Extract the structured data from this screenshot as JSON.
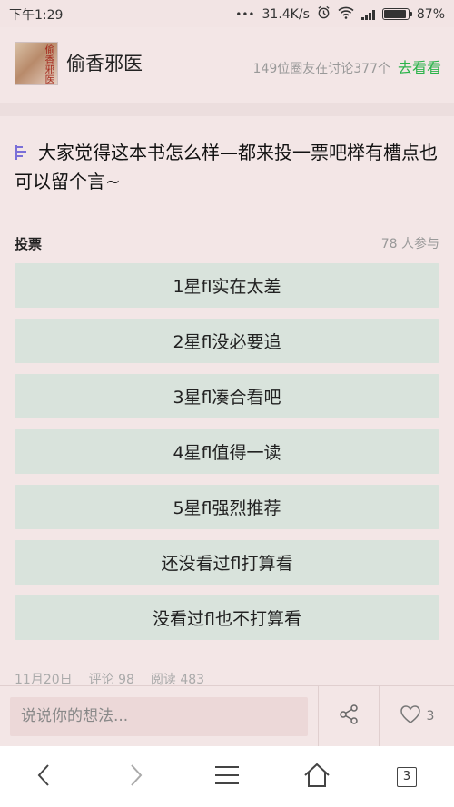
{
  "status_bar": {
    "time": "下午1:29",
    "network_speed": "31.4K/s",
    "battery": "87%"
  },
  "group": {
    "name": "偷香邪医",
    "avatar_text": "偷香邪医",
    "participants_text": "149位圈友在讨论377个",
    "go_link": "去看看"
  },
  "post": {
    "title": "大家觉得这本书怎么样—都来投一票吧榉有槽点也可以留个言~",
    "vote_label": "投票",
    "vote_participants": "78 人参与",
    "options": [
      "1星ﬂ实在太差",
      "2星ﬂ没必要追",
      "3星ﬂ凑合看吧",
      "4星ﬂ值得一读",
      "5星ﬂ强烈推荐",
      "还没看过ﬂ打算看",
      "没看过ﬂ也不打算看"
    ],
    "date": "11月20日",
    "comments": "评论 98",
    "reads": "阅读 483"
  },
  "comment_bar": {
    "placeholder": "说说你的想法...",
    "like_count": "3"
  },
  "nav": {
    "tab_count": "3"
  },
  "icons": [
    "back-icon",
    "forward-icon",
    "menu-icon",
    "home-icon",
    "tabs-icon",
    "share-icon",
    "heart-icon",
    "vote-icon",
    "wifi-icon",
    "alarm-icon",
    "signal-icon",
    "battery-icon"
  ],
  "colors": {
    "background": "#f3e6e6",
    "option_bg": "#d9e3dc",
    "link_green": "#2bb34a",
    "vote_icon": "#7a6fd8"
  }
}
